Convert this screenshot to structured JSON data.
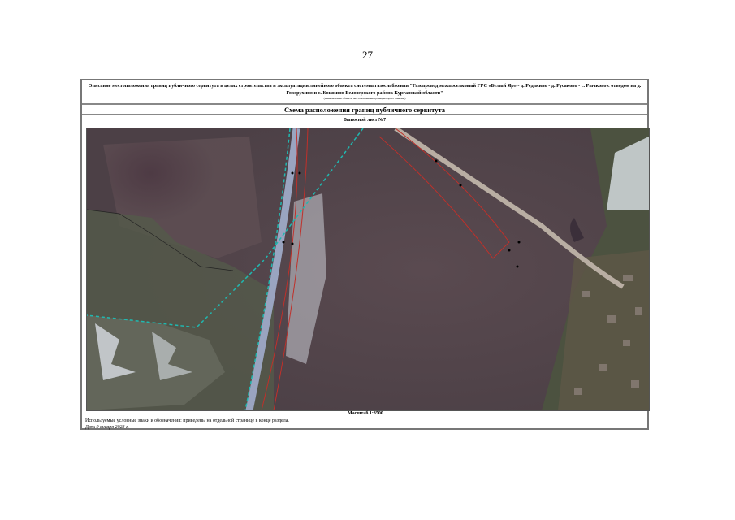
{
  "page_number": "27",
  "header": {
    "description": "Описание местоположения границ публичного сервитута в целях строительства и эксплуатации линейного объекта системы газоснабжения \"Газопровод межпоселковый ГРС «Белый Яр» - д. Редькино - д. Русаково - с. Рычково с отводом на д. Говорухино и с. Кошкино Белозерского района Курганской области\"",
    "subcaption": "(наименование объекта, местоположение границ которого описано)",
    "title": "Схема расположения границ публичного сервитута",
    "sheet": "Выносной лист №7"
  },
  "map": {
    "type": "satellite-image",
    "colors": {
      "servitude_boundary": "#c0302a",
      "zone_boundary": "#20b8b0",
      "road": "#9aa4c0"
    }
  },
  "footer": {
    "scale": "Масштаб 1:3500",
    "legend": "Используемые условные знаки и обозначения: приведены на отдельной странице в конце раздела.",
    "date_label": "Дата",
    "date_value": "9 января 2023 г."
  }
}
